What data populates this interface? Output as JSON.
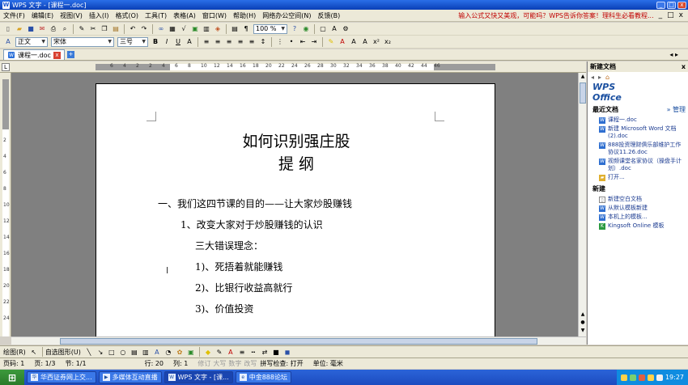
{
  "titlebar": {
    "title": "WPS 文字 - [课程一.doc]",
    "app_badge": "W",
    "minimize": "_",
    "maximize": "□",
    "close": "x"
  },
  "menu": {
    "items": [
      "文件(F)",
      "编辑(E)",
      "视图(V)",
      "插入(I)",
      "格式(O)",
      "工具(T)",
      "表格(A)",
      "窗口(W)",
      "帮助(H)",
      "网络办公空间(N)",
      "反馈(B)"
    ],
    "promo": "输入公式又快又美观，可能吗？WPS告诉你答案！理科生必看教程...",
    "window_controls": [
      "_",
      "□",
      "x"
    ]
  },
  "toolbar2": {
    "style": "正文",
    "font": "宋体",
    "size": "三号",
    "bold": "B",
    "italic": "I",
    "underline": "U"
  },
  "toolbar1": {
    "zoom": "100 %"
  },
  "tabs": {
    "active": "课程一.doc",
    "close": "x",
    "new": "+",
    "arrows": "◂ ▸"
  },
  "ruler": {
    "h_labels": [
      "6",
      "4",
      "2",
      "2",
      "4",
      "6",
      "8",
      "10",
      "12",
      "14",
      "16",
      "18",
      "20",
      "22",
      "24",
      "26",
      "28",
      "30",
      "32",
      "34",
      "36",
      "38",
      "40",
      "42",
      "44",
      "46"
    ],
    "v_labels": [
      "2",
      "4",
      "6",
      "8",
      "10",
      "12",
      "14",
      "16",
      "18",
      "20",
      "22",
      "24"
    ]
  },
  "document": {
    "title": "如何识别强庄股",
    "subtitle": "提  纲",
    "lines": [
      {
        "text": "一、我们这四节课的目的——让大家炒股赚钱",
        "bold": true
      },
      {
        "text": "1、改变大家对于炒股赚钱的认识",
        "bold": true
      },
      {
        "text": "三大错误理念：",
        "bold": true
      },
      {
        "text": "1)、死捂着就能赚钱",
        "bold": true
      },
      {
        "text": "2)、比银行收益高就行",
        "bold": true
      },
      {
        "text": "3)、价值投资",
        "bold": true
      }
    ]
  },
  "taskpane": {
    "header": "新建文档",
    "close": "x",
    "nav": [
      "◂",
      "▸",
      "⌂"
    ],
    "logo": "WPS Office",
    "recent_title": "最近文档",
    "manage": "» 管理",
    "recent": [
      "课程一.doc",
      "新建 Microsoft Word 文档(2).doc",
      "888投资理财俱乐部维护工作协议11.26.doc",
      "视频课堂名家协议（操盘手计划）.doc",
      "打开..."
    ],
    "new_title": "新建",
    "new_items": [
      "新建空白文档",
      "从默认模板新建",
      "本机上的模板...",
      "Kingsoft Online 模板"
    ]
  },
  "drawbar": {
    "draw": "绘图(R)",
    "autoshape": "自选图形(U)"
  },
  "status": {
    "fields": [
      "页码: 1",
      "页: 1/3",
      "节: 1/1",
      "行: 20",
      "列: 1"
    ],
    "dim_fields": [
      "修订",
      "大写",
      "数字",
      "改写"
    ],
    "fields2": [
      "拼写检查: 打开",
      "单位: 毫米"
    ]
  },
  "taskbar": {
    "start": "⊞",
    "tasks": [
      "华西证券网上交...",
      "多媒体互动直播",
      "WPS 文字 - [课...",
      "中金888论坛"
    ],
    "time": "19:27"
  }
}
